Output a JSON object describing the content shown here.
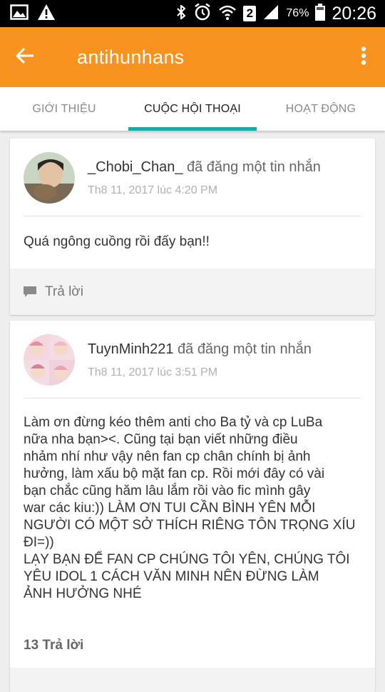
{
  "status_bar": {
    "sim_slot": "2",
    "battery": "76%",
    "time": "20:26"
  },
  "app_bar": {
    "title": "antihunhans"
  },
  "tabs": [
    {
      "label": "GIỚI THIỆU"
    },
    {
      "label": "CUỘC HỘI THOẠI",
      "active": true
    },
    {
      "label": "HOẠT ĐỘNG"
    }
  ],
  "posts": [
    {
      "author": "_Chobi_Chan_",
      "action": " đã đăng một tin nhắn",
      "time": "Th8 11, 2017 lúc 4:20 PM",
      "body": "Quá ngông cuồng rồi đấy bạn!!",
      "reply_label": "Trả lời"
    },
    {
      "author": "TuynMinh221",
      "action": " đã đăng một tin nhắn",
      "time": "Th8 11, 2017 lúc 3:51 PM",
      "body_lines": [
        "Làm ơn đừng kéo thêm anti cho Ba tỷ và cp LuBa",
        "nữa nha bạn><. Cũng tại bạn viết những điều",
        "nhảm nhí như vậy nên fan cp chân chính bị ảnh",
        "hưởng, làm xấu bộ mặt fan cp. Rồi mới đây có vài",
        "bạn chắc cũng hăm lâu lắm rồi vào fic mình gây",
        "war các kiu:)) LÀM ƠN TUI CẦN BÌNH YÊN MỖI",
        "NGƯỜI CÓ MỘT SỞ THÍCH RIÊNG TÔN TRỌNG XÍU",
        "ĐI=))",
        "LẠY BẠN ĐỂ FAN CP CHÚNG TÔI YÊN, CHÚNG TÔI",
        "YÊU IDOL 1 CÁCH VĂN MINH NÊN ĐỪNG LÀM",
        "ẢNH HƯỞNG NHÉ"
      ],
      "reply_count_label": "13 Trả lời"
    }
  ]
}
